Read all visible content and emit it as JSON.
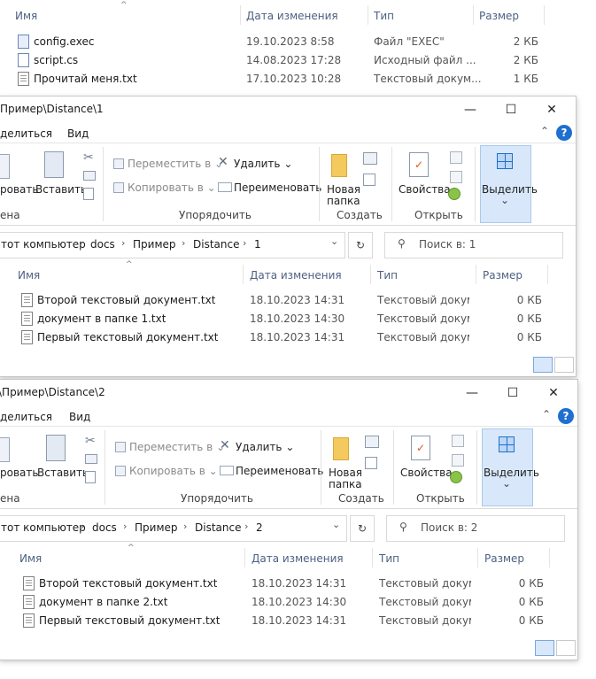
{
  "columns": {
    "name": "Имя",
    "date": "Дата изменения",
    "type": "Тип",
    "size": "Размер"
  },
  "top_files": [
    {
      "name": "config.exec",
      "date": "19.10.2023 8:58",
      "type": "Файл \"EXEC\"",
      "size": "2 КБ",
      "icon": "exec-file-icon"
    },
    {
      "name": "script.cs",
      "date": "14.08.2023 17:28",
      "type": "Исходный файл ...",
      "size": "2 КБ",
      "icon": "cs-file-icon"
    },
    {
      "name": "Прочитай меня.txt",
      "date": "17.10.2023 10:28",
      "type": "Текстовый докум...",
      "size": "1 КБ",
      "icon": "text-file-icon"
    }
  ],
  "ribbon": {
    "menu_share": "делиться",
    "menu_view": "Вид",
    "copy_path": "ровать",
    "paste": "Вставить",
    "clipboard_group": "ена",
    "move_to": "Переместить в",
    "copy_to": "Копировать в",
    "delete": "Удалить",
    "rename": "Переименовать",
    "organize_group": "Упорядочить",
    "new_folder_1": "Новая",
    "new_folder_2": "папка",
    "create_group": "Создать",
    "properties": "Свойства",
    "open_group": "Открыть",
    "select": "Выделить"
  },
  "windows": [
    {
      "title": "Пример\\Distance\\1",
      "breadcrumbs": [
        "тот компьютер",
        "docs",
        "Пример",
        "Distance",
        "1"
      ],
      "search_placeholder": "Поиск в: 1",
      "files": [
        {
          "name": "Второй текстовый документ.txt",
          "date": "18.10.2023 14:31",
          "type": "Текстовый докум...",
          "size": "0 КБ"
        },
        {
          "name": "документ в папке 1.txt",
          "date": "18.10.2023 14:30",
          "type": "Текстовый докум...",
          "size": "0 КБ"
        },
        {
          "name": "Первый текстовый документ.txt",
          "date": "18.10.2023 14:31",
          "type": "Текстовый докум...",
          "size": "0 КБ"
        }
      ]
    },
    {
      "title": "\\Пример\\Distance\\2",
      "breadcrumbs": [
        "тот компьютер",
        "docs",
        "Пример",
        "Distance",
        "2"
      ],
      "search_placeholder": "Поиск в: 2",
      "files": [
        {
          "name": "Второй текстовый документ.txt",
          "date": "18.10.2023 14:31",
          "type": "Текстовый докум...",
          "size": "0 КБ"
        },
        {
          "name": "документ в папке 2.txt",
          "date": "18.10.2023 14:30",
          "type": "Текстовый докум...",
          "size": "0 КБ"
        },
        {
          "name": "Первый текстовый документ.txt",
          "date": "18.10.2023 14:31",
          "type": "Текстовый докум...",
          "size": "0 КБ"
        }
      ]
    }
  ],
  "window_controls": {
    "minimize": "—",
    "maximize": "☐",
    "close": "✕"
  },
  "glyphs": {
    "help": "?",
    "refresh": "↻",
    "chevron": "›",
    "dropdown": "⌄",
    "sort_up": "^",
    "search": "⚲",
    "collapse": "⌃"
  },
  "colors": {
    "accent": "#1f6fd0",
    "header_text": "#4d6082",
    "select_bg": "#d8e8fa"
  }
}
